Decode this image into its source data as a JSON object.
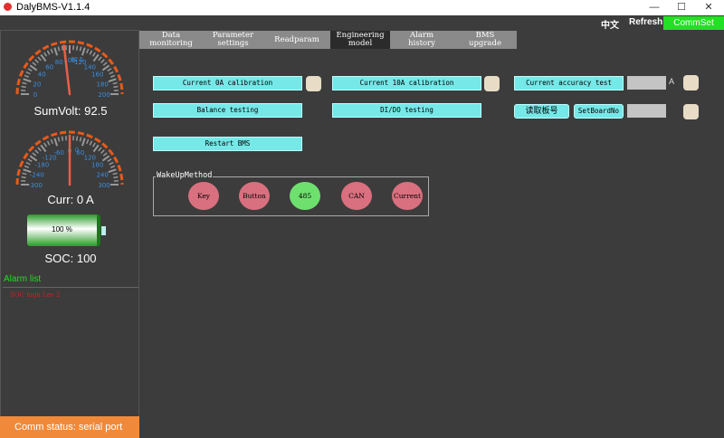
{
  "window": {
    "title": "DalyBMS-V1.1.4",
    "minimize": "—",
    "maximize": "☐",
    "close": "✕"
  },
  "topbar": {
    "language": "中文",
    "refresh": "Refresh",
    "commset": "CommSet"
  },
  "gauges": {
    "voltage": {
      "label": "SumVolt: 92.5",
      "value": 92.5,
      "min": 0,
      "max": 200,
      "ticks": [
        "0",
        "20",
        "40",
        "60",
        "80",
        "100",
        "120",
        "140",
        "160",
        "180",
        "200"
      ],
      "center_text": "92.5"
    },
    "current": {
      "label": "Curr: 0 A",
      "value": 0,
      "min": -300,
      "max": 300,
      "ticks": [
        "-300",
        "-240",
        "-180",
        "-120",
        "-60",
        "0",
        "60",
        "120",
        "180",
        "240",
        "300"
      ],
      "center_text": "0"
    }
  },
  "battery": {
    "text": "100 %",
    "soc": 100,
    "label": "SOC: 100"
  },
  "alarm": {
    "title": "Alarm list",
    "items": [
      "SOC high Lev 2"
    ]
  },
  "status": "Comm status: serial port",
  "tabs": [
    {
      "label": "Data\nmonitoring"
    },
    {
      "label": "Parameter\nsettings"
    },
    {
      "label": "Readparam"
    },
    {
      "label": "Engineering\nmodel",
      "active": true
    },
    {
      "label": "Alarm history"
    },
    {
      "label": "BMS upgrade"
    }
  ],
  "buttons": {
    "cal0": "Current 0A calibration",
    "cal10": "Current 10A calibration",
    "accuracy": "Current accuracy test",
    "unit": "A",
    "balance": "Balance testing",
    "dido": "DI/DO testing",
    "readboard": "读取板号",
    "setboard": "SetBoardNo",
    "restart": "Restart BMS"
  },
  "wakeup": {
    "title": "WakeUpMethod",
    "items": [
      {
        "label": "Key",
        "active": false
      },
      {
        "label": "Button",
        "active": false
      },
      {
        "label": "485",
        "active": true
      },
      {
        "label": "CAN",
        "active": false
      },
      {
        "label": "Current",
        "active": false
      }
    ]
  },
  "colors": {
    "accent": "#22e022",
    "button": "#76e8e8",
    "gauge_arc": "#e85a1a",
    "tick_text": "#3a8ee0",
    "status_bar": "#f08a3a",
    "alarm_text": "#d02020",
    "inactive": "#d9707f",
    "active": "#6ee06e"
  }
}
